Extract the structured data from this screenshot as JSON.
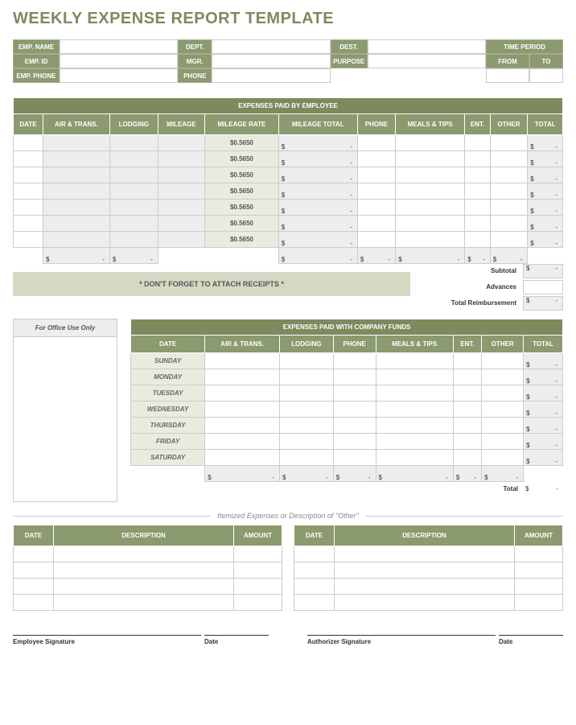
{
  "title": "WEEKLY EXPENSE REPORT TEMPLATE",
  "header": {
    "emp_name": "EMP. NAME",
    "emp_id": "EMP. ID",
    "emp_phone": "EMP. PHONE",
    "dept": "DEPT.",
    "mgr": "MGR.",
    "phone": "PHONE",
    "dest": "DEST.",
    "purpose": "PURPOSE",
    "time_period": "TIME PERIOD",
    "from": "FROM",
    "to": "TO"
  },
  "emp_expenses": {
    "title": "EXPENSES PAID BY EMPLOYEE",
    "cols": [
      "DATE",
      "AIR & TRANS.",
      "LODGING",
      "MILEAGE",
      "MILEAGE RATE",
      "MILEAGE TOTAL",
      "PHONE",
      "MEALS & TIPS",
      "ENT.",
      "OTHER",
      "TOTAL"
    ],
    "rate": "$0.5650",
    "row_count": 7,
    "note": "* DON'T FORGET TO ATTACH RECEIPTS *",
    "subtotal": "Subtotal",
    "advances": "Advances",
    "reimb": "Total Reimbursement"
  },
  "office": "For Office Use Only",
  "comp_expenses": {
    "title": "EXPENSES PAID WITH COMPANY FUNDS",
    "cols": [
      "DATE",
      "AIR & TRANS.",
      "LODGING",
      "PHONE",
      "MEALS & TIPS",
      "ENT.",
      "OTHER",
      "TOTAL"
    ],
    "days": [
      "SUNDAY",
      "MONDAY",
      "TUESDAY",
      "WEDNESDAY",
      "THURSDAY",
      "FRIDAY",
      "SATURDAY"
    ],
    "total": "Total"
  },
  "itemized": {
    "title": "Itemized Expenses or Description of \"Other\"",
    "cols": [
      "DATE",
      "DESCRIPTION",
      "AMOUNT"
    ],
    "row_count": 4
  },
  "sig": {
    "emp": "Employee Signature",
    "date": "Date",
    "auth": "Authorizer Signature"
  }
}
